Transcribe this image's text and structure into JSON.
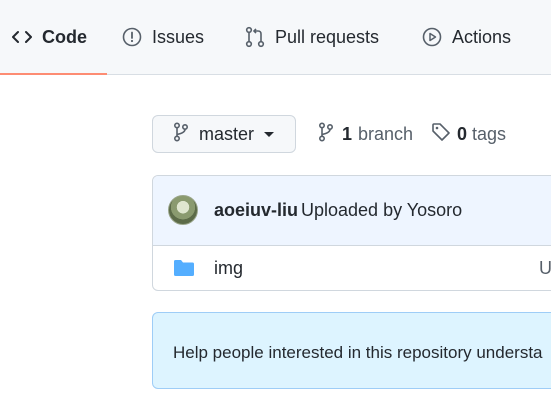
{
  "tabs": {
    "code": "Code",
    "issues": "Issues",
    "pulls": "Pull requests",
    "actions": "Actions"
  },
  "branch": {
    "current": "master",
    "branch_count": "1",
    "branch_label": "branch",
    "tag_count": "0",
    "tag_label": "tags"
  },
  "commit": {
    "author": "aoeiuv-liu",
    "message": "Uploaded by Yosoro"
  },
  "files": [
    {
      "name": "img",
      "commit": "U",
      "icon": "folder-icon"
    }
  ],
  "readme_banner": {
    "text": "Help people interested in this repository understa"
  },
  "colors": {
    "tab_underline": "#fd8c73",
    "folder": "#54aeff",
    "commit_bg": "#eef5ff",
    "banner_bg": "#ddf4ff"
  }
}
